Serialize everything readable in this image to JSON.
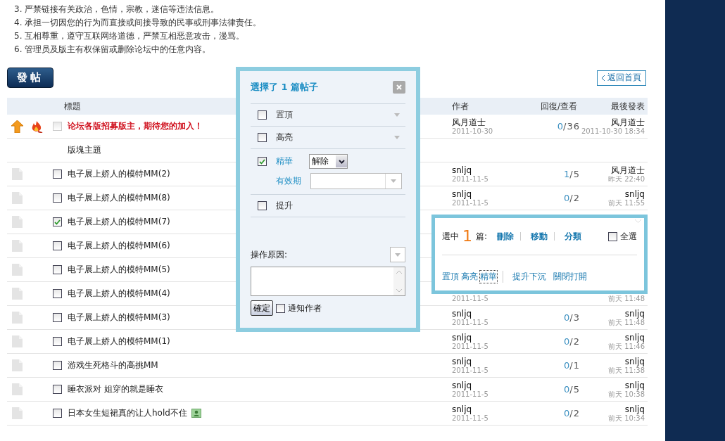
{
  "rules": [
    "3. 严禁链接有关政治，色情，宗教，迷信等违法信息。",
    "4. 承担一切因您的行为而直接或间接导致的民事或刑事法律责任。",
    "5. 互相尊重，遵守互联网络道德，严禁互相恶意攻击，漫骂。",
    "6. 管理员及版主有权保留或删除论坛中的任意内容。"
  ],
  "post_button": "發帖",
  "back_button": "返回首頁",
  "table": {
    "columns": [
      "標題",
      "作者",
      "回復/查看",
      "最後發表"
    ],
    "rows": [
      {
        "kind": "pinned",
        "checked": false,
        "title": "论坛各版招募版主，期待您的加入！",
        "author": "风月道士",
        "author_date": "2011-10-30",
        "replies": "0",
        "views": "/36",
        "last_poster": "风月道士",
        "last_time": "2011-10-30 18:34"
      },
      {
        "kind": "section",
        "title": "版塊主題"
      },
      {
        "kind": "thread",
        "checked": false,
        "title": "电子展上娇人的模特MM(2)",
        "author": "snljq",
        "author_date": "2011-11-5",
        "replies": "1",
        "views": "/5",
        "last_poster": "风月道士",
        "last_time": "昨天 22:40"
      },
      {
        "kind": "thread",
        "checked": false,
        "title": "电子展上娇人的模特MM(8)",
        "author": "snljq",
        "author_date": "2011-11-5",
        "replies": "0",
        "views": "/2",
        "last_poster": "snljq",
        "last_time": "前天 11:55"
      },
      {
        "kind": "thread",
        "checked": true,
        "title": "电子展上娇人的模特MM(7)"
      },
      {
        "kind": "thread",
        "checked": false,
        "title": "电子展上娇人的模特MM(6)"
      },
      {
        "kind": "thread",
        "checked": false,
        "title": "电子展上娇人的模特MM(5)"
      },
      {
        "kind": "thread",
        "checked": false,
        "title": "电子展上娇人的模特MM(4)",
        "author_date": "2011-11-5",
        "last_time": "前天 11:48"
      },
      {
        "kind": "thread",
        "checked": false,
        "title": "电子展上娇人的模特MM(3)",
        "author": "snljq",
        "author_date": "2011-11-5",
        "replies": "0",
        "views": "/3",
        "last_poster": "snljq",
        "last_time": "前天 11:48"
      },
      {
        "kind": "thread",
        "checked": false,
        "title": "电子展上娇人的模特MM(1)",
        "author": "snljq",
        "author_date": "2011-11-5",
        "replies": "0",
        "views": "/2",
        "last_poster": "snljq",
        "last_time": "前天 11:46"
      },
      {
        "kind": "thread",
        "checked": false,
        "title": "游戏生死格斗的高挑MM",
        "author": "snljq",
        "author_date": "2011-11-5",
        "replies": "0",
        "views": "/1",
        "last_poster": "snljq",
        "last_time": "前天 11:38"
      },
      {
        "kind": "thread",
        "checked": false,
        "title": "睡衣派对 姐穿的就是睡衣",
        "author": "snljq",
        "author_date": "2011-11-5",
        "replies": "0",
        "views": "/5",
        "last_poster": "snljq",
        "last_time": "前天 10:38"
      },
      {
        "kind": "thread",
        "checked": false,
        "title": "日本女生短裙真的让人hold不住",
        "has_image": true,
        "author": "snljq",
        "author_date": "2011-11-5",
        "replies": "0",
        "views": "/2",
        "last_poster": "snljq",
        "last_time": "前天 10:34"
      }
    ]
  },
  "moderation_dialog": {
    "title": "選擇了 1 篇帖子",
    "options": [
      {
        "kind": "dropdown",
        "label": "置頂",
        "checked": false
      },
      {
        "kind": "dropdown",
        "label": "高亮",
        "checked": false
      },
      {
        "kind": "select",
        "label": "精華",
        "checked": true,
        "value": "解除",
        "sub_label": "有效期"
      },
      {
        "kind": "plain",
        "label": "提升",
        "checked": false
      }
    ],
    "reason_label": "操作原因:",
    "confirm_button": "確定",
    "notify": {
      "label": "通知作者",
      "checked": false
    }
  },
  "selection_bar": {
    "prefix": "選中",
    "count": "1",
    "suffix": "篇:",
    "actions": [
      "刪除",
      "移動",
      "分類"
    ],
    "select_all": {
      "label": "全選",
      "checked": false
    },
    "groups": [
      [
        {
          "label": "置頂",
          "focused": false
        },
        {
          "label": "高亮",
          "focused": false
        },
        {
          "label": "精華",
          "focused": true
        }
      ],
      [
        {
          "label": "提升下沉",
          "focused": false
        },
        {
          "label": "關閉打開",
          "focused": false
        }
      ]
    ]
  }
}
